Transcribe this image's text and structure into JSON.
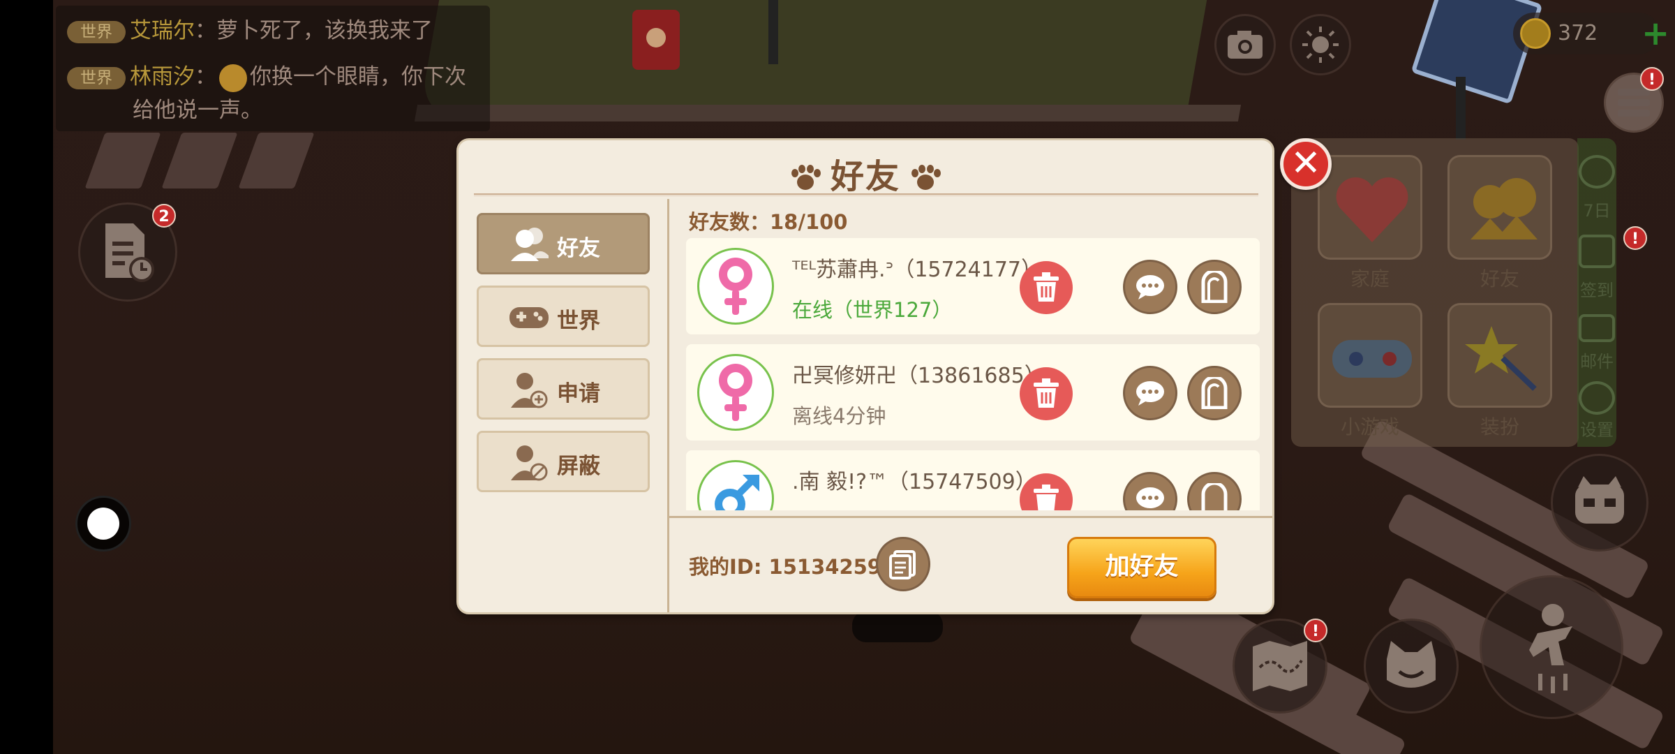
{
  "chat": {
    "line1": {
      "channel": "世界",
      "name": "艾瑞尔",
      "text": "：萝卜死了，该换我来了"
    },
    "line2": {
      "channel": "世界",
      "name": "林雨汐",
      "text": "你换一个眼睛，你下次",
      "text_cont": "给他说一声。"
    }
  },
  "hud": {
    "coins": "372",
    "plus": "+",
    "doc_badge": "2",
    "menu_badge": "!",
    "map_badge": "!",
    "checkin_badge": "!"
  },
  "side_menu": {
    "items": [
      "家庭",
      "好友",
      "小游戏",
      "装扮"
    ],
    "strip": [
      "7日",
      "签到",
      "邮件",
      "设置"
    ]
  },
  "dialog": {
    "title": "好友",
    "close": "✕",
    "tabs": [
      "好友",
      "世界",
      "申请",
      "屏蔽"
    ],
    "count_label": "好友数：18/100",
    "friends": [
      {
        "name": "ᵀᴱᴸ苏蕭冉.ᐣ（15724177）",
        "status": "在线（世界127）",
        "gender": "female"
      },
      {
        "name": "卍冥修妍卍（13861685）",
        "status": "离线4分钟",
        "gender": "female"
      },
      {
        "name": ".南 毅!?™（15747509）",
        "status": "",
        "gender": "male"
      }
    ],
    "my_id": "我的ID:  15134259",
    "add_button": "加好友"
  },
  "colors": {
    "accent_brown": "#7a5233",
    "online_green": "#4aa83a",
    "delete_red": "#e65a58",
    "add_orange": "#f6a41a",
    "close_red": "#d8312b"
  }
}
